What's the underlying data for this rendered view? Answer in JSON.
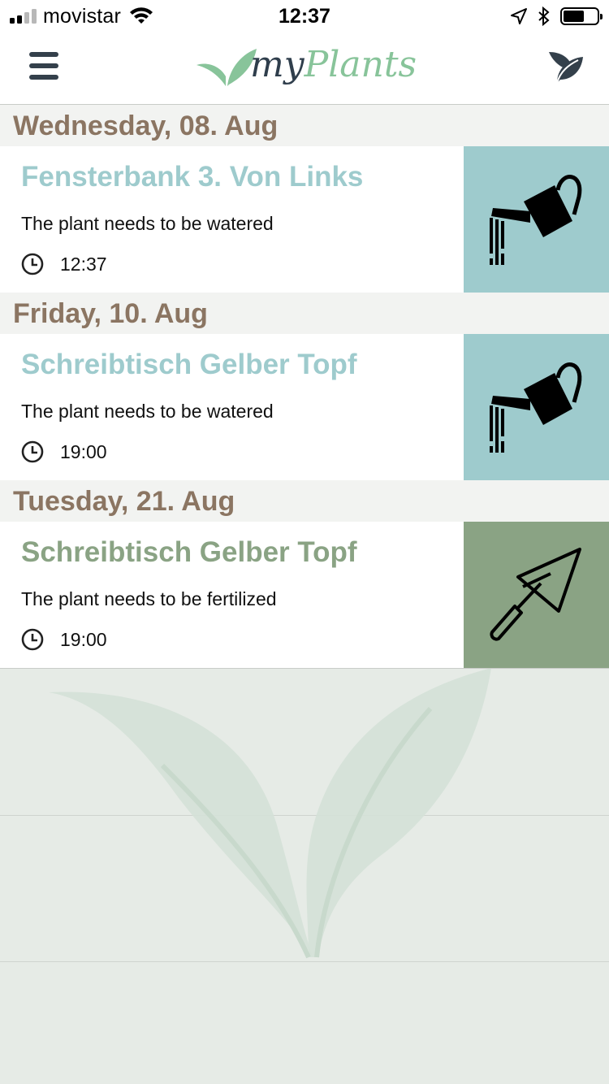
{
  "status_bar": {
    "carrier": "movistar",
    "time": "12:37"
  },
  "header": {
    "logo_my": "my",
    "logo_plants": "Plants"
  },
  "icons": {
    "menu": "hamburger-menu-icon",
    "plants": "leaf-icon",
    "clock": "clock-icon",
    "water": "watering-can-icon",
    "fertilize": "trowel-icon"
  },
  "colors": {
    "date_header_text": "#8b7562",
    "water_tile": "#9ecbcd",
    "water_title": "#9ecbcd",
    "fertilize_tile": "#8aa384",
    "fertilize_title": "#8aa384",
    "logo_green": "#88c49a",
    "logo_dark": "#2f3e4c"
  },
  "groups": [
    {
      "date": "Wednesday, 08. Aug",
      "reminders": [
        {
          "plant": "Fensterbank 3. Von Links",
          "task": "The plant needs to be watered",
          "time": "12:37",
          "type": "water"
        }
      ]
    },
    {
      "date": "Friday, 10. Aug",
      "reminders": [
        {
          "plant": "Schreibtisch Gelber Topf",
          "task": "The plant needs to be watered",
          "time": "19:00",
          "type": "water"
        }
      ]
    },
    {
      "date": "Tuesday, 21. Aug",
      "reminders": [
        {
          "plant": "Schreibtisch Gelber Topf",
          "task": "The plant needs to be fertilized",
          "time": "19:00",
          "type": "fertilize"
        }
      ]
    }
  ]
}
